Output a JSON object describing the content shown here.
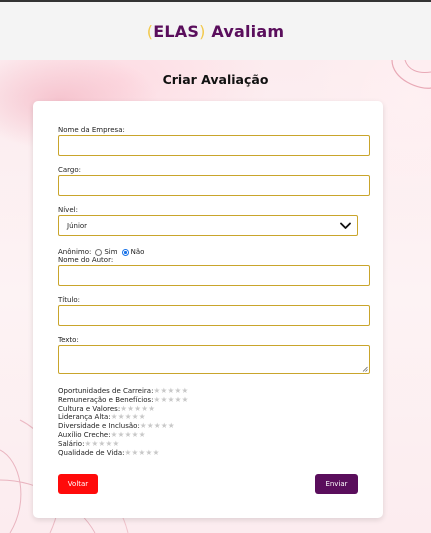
{
  "header": {
    "logo_open": "(",
    "logo_word": "ELAS",
    "logo_close": ")",
    "logo_rest": " Avaliam"
  },
  "page": {
    "title": "Criar Avaliação"
  },
  "form": {
    "company_label": "Nome da Empresa:",
    "company_value": "",
    "role_label": "Cargo:",
    "role_value": "",
    "level_label": "Nível:",
    "level_selected": "Júnior",
    "anonymous_label": "Anônimo:",
    "anonymous_yes": "Sim",
    "anonymous_no": "Não",
    "anonymous_selected": "Não",
    "author_label": "Nome do Autor:",
    "author_value": "",
    "title_label": "Título:",
    "title_value": "",
    "text_label": "Texto:",
    "text_value": ""
  },
  "ratings": [
    {
      "label": "Oportunidades de Carreira:",
      "stars": "★★★★★",
      "value": 0
    },
    {
      "label": "Remuneração e Benefícios:",
      "stars": "★★★★★",
      "value": 0
    },
    {
      "label": "Cultura e Valores:",
      "stars": "★★★★★",
      "value": 0
    },
    {
      "label": "Liderança Alta:",
      "stars": "★★★★★",
      "value": 0
    },
    {
      "label": "Diversidade e Inclusão:",
      "stars": "★★★★★",
      "value": 0
    },
    {
      "label": "Auxílio Creche:",
      "stars": "★★★★★",
      "value": 0
    },
    {
      "label": "Salário:",
      "stars": "★★★★★",
      "value": 0
    },
    {
      "label": "Qualidade de Vida:",
      "stars": "★★★★★",
      "value": 0
    }
  ],
  "buttons": {
    "back": "Voltar",
    "send": "Enviar"
  },
  "colors": {
    "brand": "#5a0e5c",
    "brand_accent": "#f2c94c",
    "back_button": "#ff0a0a",
    "field_border": "#c9a52c",
    "radio_checked": "#1a73e8"
  }
}
